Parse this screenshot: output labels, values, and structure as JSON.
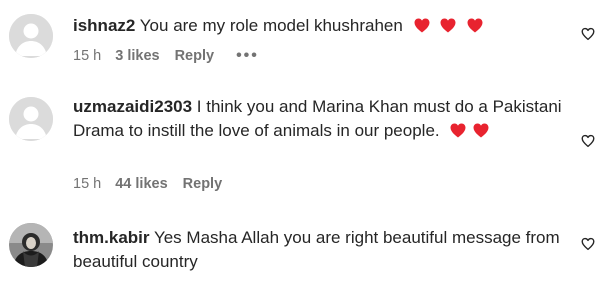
{
  "comments": [
    {
      "username": "ishnaz2",
      "text": "You are my role model khushrahen",
      "emoji_count": 3,
      "time": "15 h",
      "likes": "3 likes",
      "reply": "Reply",
      "more": "•••",
      "avatar": "default-avatar-icon"
    },
    {
      "username": "uzmazaidi2303",
      "text": "I think you and Marina Khan must do a Pakistani Drama to instill the love of animals in our people.",
      "emoji_count": 2,
      "time": "15 h",
      "likes": "44 likes",
      "reply": "Reply",
      "avatar": "default-avatar-icon"
    },
    {
      "username": "thm.kabir",
      "text": "Yes Masha Allah you are right beautiful message from beautiful country",
      "emoji_count": 0,
      "avatar": "photo-avatar"
    }
  ],
  "colors": {
    "heart_emoji": "#e8232f",
    "meta_text": "#737373",
    "default_avatar": "#dbdbdb"
  }
}
